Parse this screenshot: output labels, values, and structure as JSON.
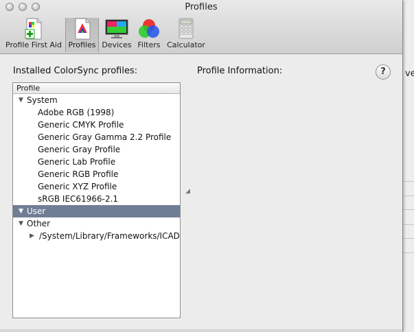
{
  "window": {
    "title": "Profiles"
  },
  "toolbar": {
    "items": [
      {
        "label": "Profile First Aid",
        "icon": "first-aid-doc-icon",
        "selected": false
      },
      {
        "label": "Profiles",
        "icon": "profiles-doc-icon",
        "selected": true
      },
      {
        "label": "Devices",
        "icon": "monitor-icon",
        "selected": false
      },
      {
        "label": "Filters",
        "icon": "color-circles-icon",
        "selected": false
      },
      {
        "label": "Calculator",
        "icon": "calculator-icon",
        "selected": false
      }
    ]
  },
  "installed": {
    "heading": "Installed ColorSync profiles:",
    "column_header": "Profile",
    "groups": [
      {
        "label": "System",
        "expanded": true,
        "items": [
          "Adobe RGB (1998)",
          "Generic CMYK Profile",
          "Generic Gray Gamma 2.2 Profile",
          "Generic Gray Profile",
          "Generic Lab Profile",
          "Generic RGB Profile",
          "Generic XYZ Profile",
          "sRGB IEC61966-2.1"
        ]
      },
      {
        "label": "User",
        "expanded": true,
        "selected": true
      },
      {
        "label": "Other",
        "expanded": true,
        "paths": [
          "/System/Library/Frameworks/ICADevices"
        ]
      }
    ]
  },
  "info": {
    "heading": "Profile Information:",
    "help_label": "?"
  },
  "background_app": {
    "fragment": "ve"
  },
  "colors": {
    "selection": "#6f7e95",
    "toolbar_selected": "#c2c2c2"
  }
}
